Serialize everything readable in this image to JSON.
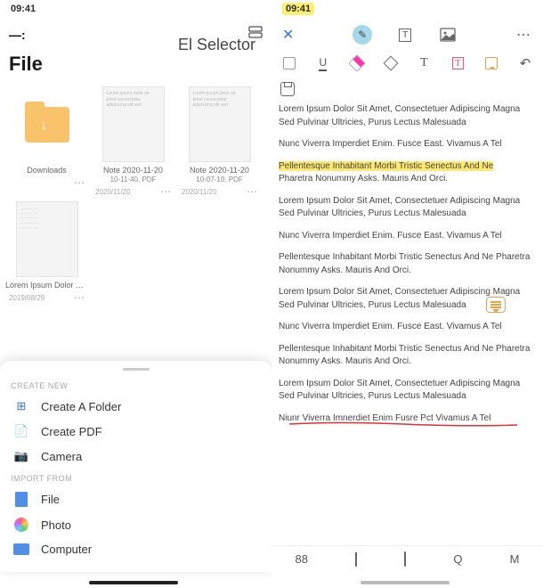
{
  "status_time": "09:41",
  "left": {
    "title": "File",
    "selector_title": "El Selector",
    "thumbs": [
      {
        "name": "Downloads",
        "date": "",
        "kind": "folder",
        "sub": ""
      },
      {
        "name": "Note 2020-11-20",
        "sub": "10-11-40. PDF",
        "date": "2020/11/20",
        "kind": "doc"
      },
      {
        "name": "Note 2020-11-20",
        "sub": "10-07-10. PDF",
        "date": "2020/11/20",
        "kind": "doc"
      },
      {
        "name": "Lorem Ipsum Dolor Sit Amet...cina.PDF",
        "sub": "",
        "date": "2019/08/29",
        "kind": "doc-lines"
      }
    ],
    "sheet": {
      "create_header": "CREATE NEW",
      "create": [
        {
          "label": "Create A Folder",
          "icon": "folder-plus-icon"
        },
        {
          "label": "Create PDF",
          "icon": "pdf-icon"
        },
        {
          "label": "Camera",
          "icon": "camera-icon"
        }
      ],
      "import_header": "IMPORT FROM",
      "import": [
        {
          "label": "File",
          "icon": "file-icon"
        },
        {
          "label": "Photo",
          "icon": "photo-icon"
        },
        {
          "label": "Computer",
          "icon": "computer-icon"
        }
      ]
    }
  },
  "right": {
    "paras": [
      "Lorem Ipsum Dolor Sit Amet, Consectetuer Adipiscing Magna Sed Pulvinar Ultricies, Purus Lectus Malesuada",
      "Nunc Viverra Imperdiet Enim. Fusce East. Vivamus A Tel",
      "Pellentesque Inhabitant Morbi Tristic Senectus And Ne",
      "Pharetra Nonummy Asks. Mauris And Orci.",
      "Lorem Ipsum Dolor Sit Amet, Consectetuer Adipiscing Magna Sed Pulvinar Ultricies, Purus Lectus Malesuada",
      "Nunc Viverra Imperdiet Enim. Fusce East. Vivamus A Tel",
      "Pellentesque Inhabitant Morbi Tristic Senectus And Ne Pharetra Nonummy Asks. Mauris And Orci.",
      "Lorem Ipsum Dolor Sit Amet, Consectetuer Adipiscing Magna Sed Pulvinar Ultricies, Purus Lectus Malesuada",
      "Nunc Viverra Imperdiet Enim. Fusce East. Vivamus A Tel",
      "Pellentesque Inhabitant Morbi Tristic Senectus And Ne Pharetra Nonummy Asks. Mauris And Orci.",
      "Lorem Ipsum Dolor Sit Amet, Consectetuer Adipiscing Magna Sed Pulvinar Ultricies, Purus Lectus Malesuada",
      "Niunr Viverra Imnerdiet Enim Fusre Pct Vivamus A Tel"
    ],
    "bottom": {
      "page": "88",
      "search": "Q",
      "menu": "M"
    }
  }
}
